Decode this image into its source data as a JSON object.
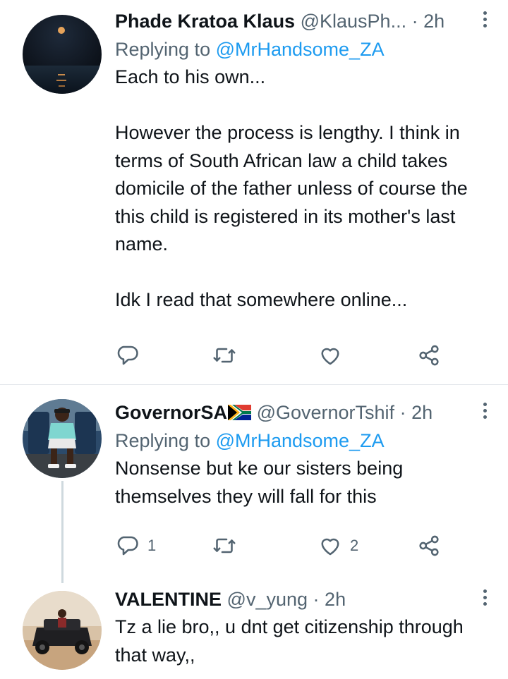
{
  "tweets": [
    {
      "name": "Phade Kratoa Klaus",
      "handle": "@KlausPh...",
      "time": "2h",
      "replying_prefix": "Replying to ",
      "replying_to": "@MrHandsome_ZA",
      "text": "Each to his own...\n\nHowever the process is lengthy. I think in terms of South African law a child takes domicile of the father unless of course the this child is registered in its mother's last name.\n\nIdk I read that somewhere online...",
      "reply_count": "",
      "like_count": ""
    },
    {
      "name": "GovernorSA",
      "handle": "@GovernorTshif",
      "time": "2h",
      "replying_prefix": "Replying to ",
      "replying_to": "@MrHandsome_ZA",
      "text": "Nonsense but ke our sisters being themselves they will fall for this",
      "reply_count": "1",
      "like_count": "2"
    },
    {
      "name": "VALENTINE",
      "handle": "@v_yung",
      "time": "2h",
      "text": "Tz a lie bro,, u dnt get citizenship through that way,,"
    }
  ],
  "separator": "·",
  "icons": {
    "reply": "reply-icon",
    "retweet": "retweet-icon",
    "like": "heart-icon",
    "share": "share-icon",
    "more": "more-options-icon"
  },
  "colors": {
    "link": "#1d9bf0",
    "secondary": "#536471",
    "text": "#0f1419"
  }
}
